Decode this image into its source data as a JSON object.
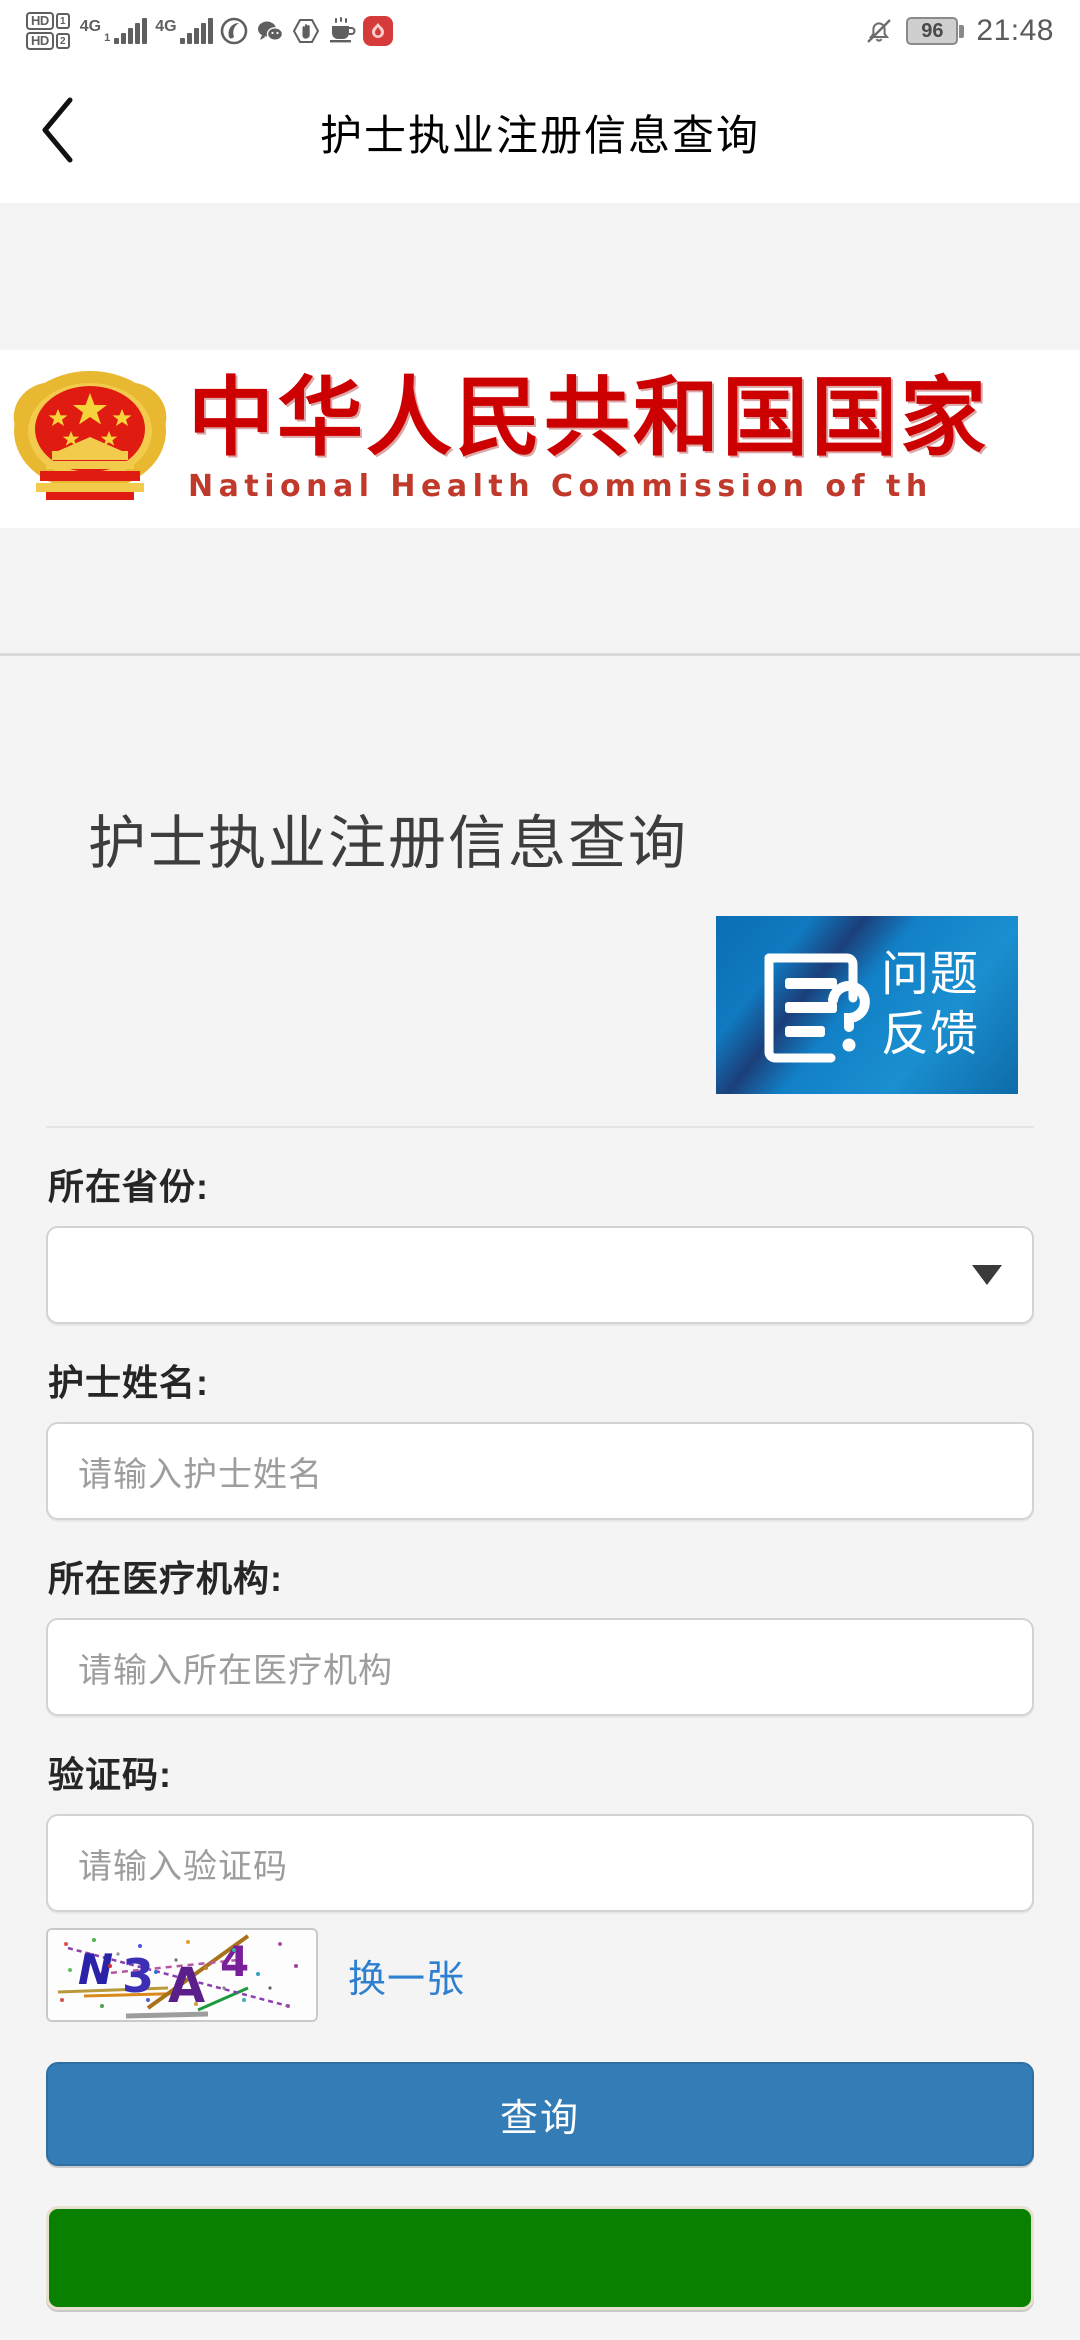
{
  "status_bar": {
    "hd_labels": [
      "HD",
      "HD"
    ],
    "sim1_index": "1",
    "sim2_index": "2",
    "network_1": "4G",
    "network_2": "4G",
    "icons": [
      "hd-sim1-icon",
      "hd-sim2-icon",
      "signal-4g-sim1-icon",
      "signal-4g-sim2-icon",
      "browser-icon",
      "wechat-icon",
      "block-hand-icon",
      "coffee-cup-icon",
      "red-app-icon"
    ],
    "mute_icon": "bell-muted-icon",
    "battery_level": "96",
    "time": "21:48"
  },
  "navbar": {
    "back_icon": "back-chevron-icon",
    "title": "护士执业注册信息查询"
  },
  "banner": {
    "emblem_icon": "china-national-emblem-icon",
    "title_cn": "中华人民共和国国家",
    "title_en": "National Health Commission of th"
  },
  "main": {
    "page_title": "护士执业注册信息查询",
    "feedback": {
      "icon": "document-question-icon",
      "line1": "问题",
      "line2": "反馈",
      "bg_color": "#1079bf"
    },
    "fields": [
      {
        "name": "province",
        "label": "所在省份:",
        "type": "select",
        "value": "",
        "placeholder": "",
        "caret_icon": "chevron-down-icon"
      },
      {
        "name": "nurse-name",
        "label": "护士姓名:",
        "type": "text",
        "value": "",
        "placeholder": "请输入护士姓名"
      },
      {
        "name": "medical-institution",
        "label": "所在医疗机构:",
        "type": "text",
        "value": "",
        "placeholder": "请输入所在医疗机构"
      },
      {
        "name": "captcha",
        "label": "验证码:",
        "type": "text",
        "value": "",
        "placeholder": "请输入验证码"
      }
    ],
    "captcha": {
      "code": "N3A4",
      "refresh_label": "换一张",
      "refresh_color": "#2f7fd0"
    },
    "buttons": [
      {
        "name": "query",
        "label": "查询",
        "color": "#347cb5"
      },
      {
        "name": "green-action",
        "label": "",
        "color": "#0a8000"
      }
    ]
  }
}
